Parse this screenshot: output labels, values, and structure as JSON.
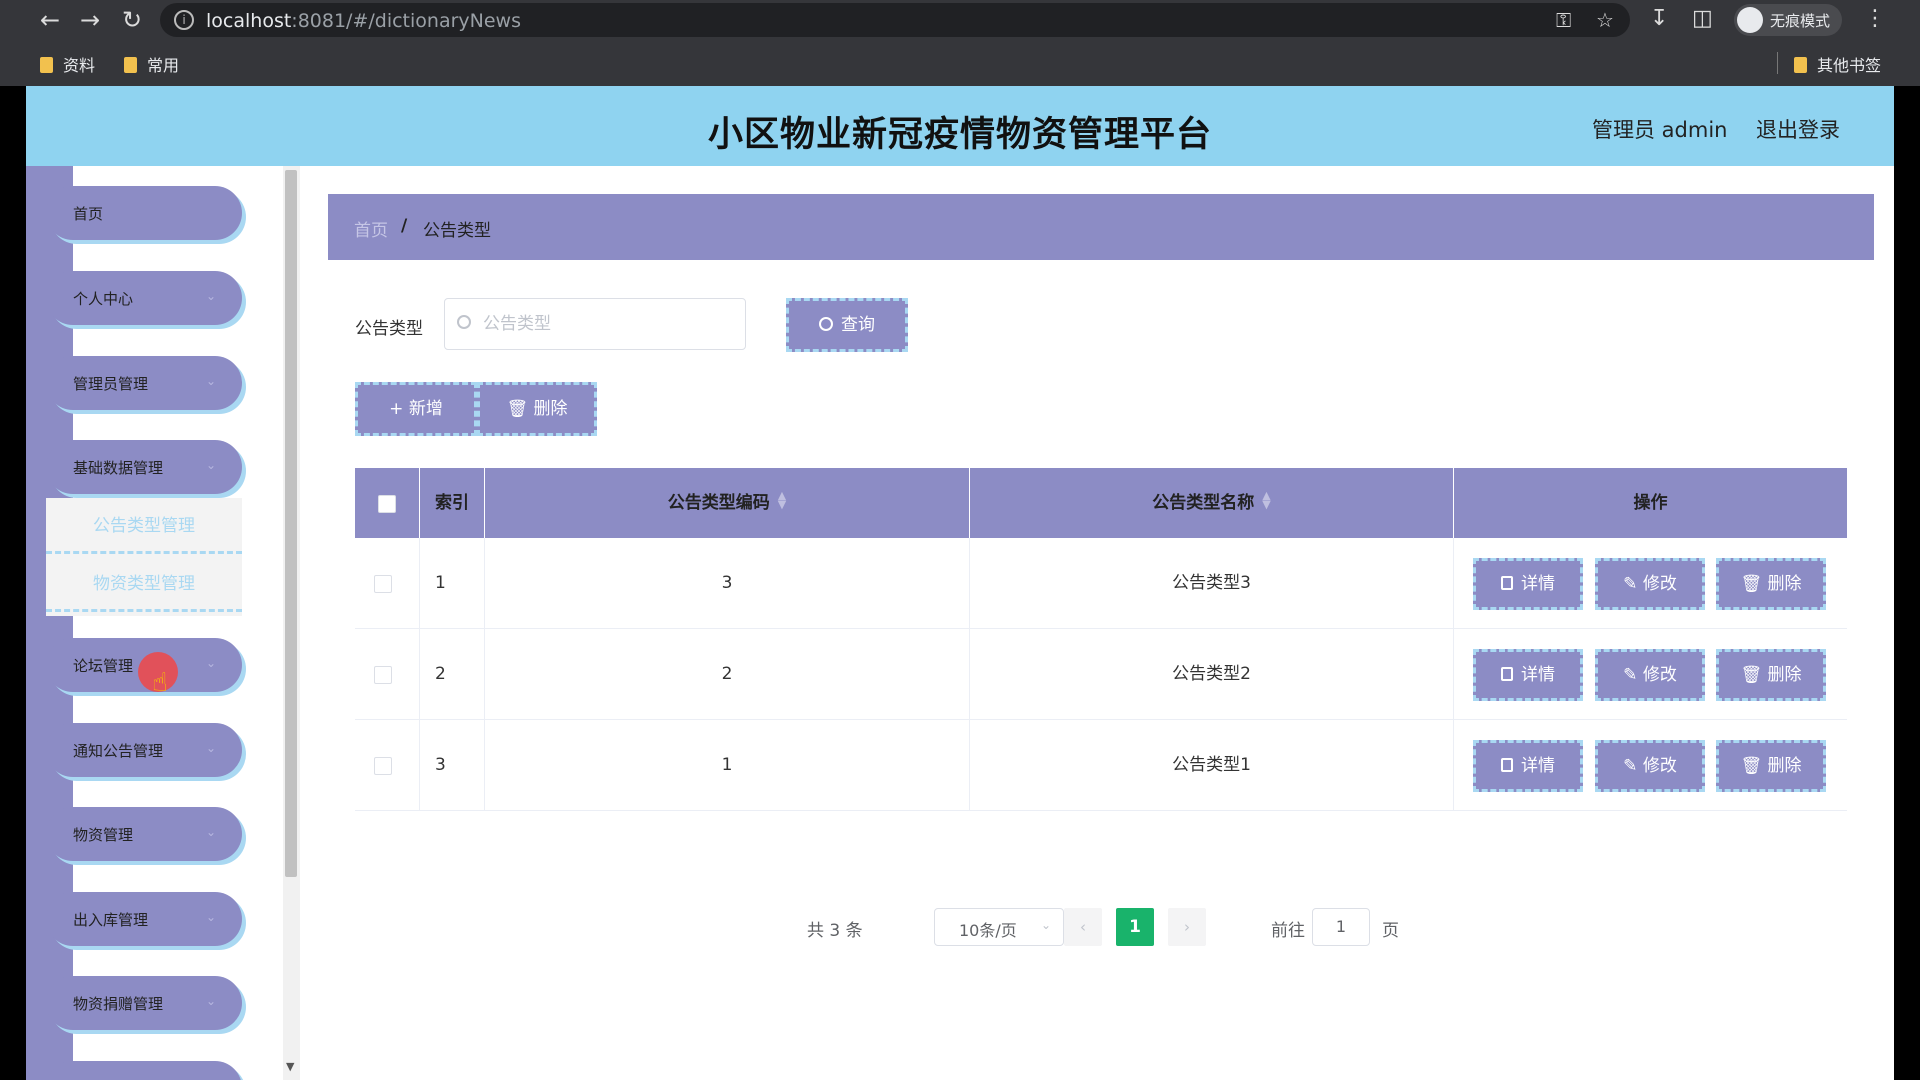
{
  "browser": {
    "url_host": "localhost",
    "url_rest": ":8081/#/dictionaryNews",
    "profile_label": "无痕模式",
    "bookmarks": [
      "资料",
      "常用"
    ],
    "other_bookmarks": "其他书签"
  },
  "header": {
    "title": "小区物业新冠疫情物资管理平台",
    "user": "管理员 admin",
    "logout": "退出登录"
  },
  "sidebar": {
    "items": [
      {
        "label": "首页"
      },
      {
        "label": "个人中心"
      },
      {
        "label": "管理员管理"
      },
      {
        "label": "基础数据管理"
      },
      {
        "label": "论坛管理"
      },
      {
        "label": "通知公告管理"
      },
      {
        "label": "物资管理"
      },
      {
        "label": "出入库管理"
      },
      {
        "label": "物资捐赠管理"
      }
    ],
    "submenu": [
      "公告类型管理",
      "物资类型管理"
    ]
  },
  "breadcrumb": {
    "home": "首页",
    "separator": "/",
    "current": "公告类型"
  },
  "search": {
    "label": "公告类型",
    "placeholder": "公告类型",
    "query_button": "查询"
  },
  "toolbar": {
    "add_button": "新增",
    "delete_button": "删除"
  },
  "table": {
    "columns": [
      "索引",
      "公告类型编码",
      "公告类型名称",
      "操作"
    ],
    "rows": [
      {
        "index": "1",
        "code": "3",
        "name": "公告类型3"
      },
      {
        "index": "2",
        "code": "2",
        "name": "公告类型2"
      },
      {
        "index": "3",
        "code": "1",
        "name": "公告类型1"
      }
    ],
    "actions": {
      "detail": "详情",
      "edit": "修改",
      "delete": "删除"
    }
  },
  "pagination": {
    "total": "共 3 条",
    "page_size": "10条/页",
    "current_page": "1",
    "goto_label": "前往",
    "goto_value": "1",
    "page_suffix": "页"
  },
  "colors": {
    "header_bg": "#8fd3f0",
    "accent_purple": "#8c8cc5",
    "dash_blue": "#a9d8f2",
    "pager_active": "#19b36b"
  }
}
